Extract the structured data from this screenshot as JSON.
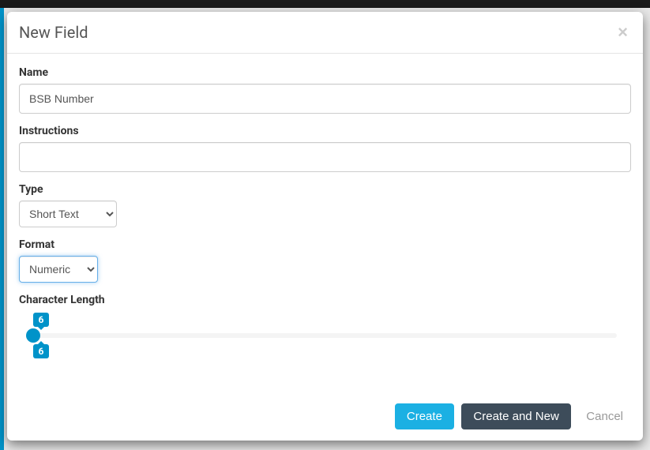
{
  "modal": {
    "title": "New Field",
    "close_label": "×"
  },
  "form": {
    "name": {
      "label": "Name",
      "value": "BSB Number"
    },
    "instructions": {
      "label": "Instructions",
      "value": ""
    },
    "type": {
      "label": "Type",
      "value": "Short Text"
    },
    "format": {
      "label": "Format",
      "value": "Numeric"
    },
    "char_length": {
      "label": "Character Length",
      "min_value": "6",
      "max_value": "6"
    }
  },
  "footer": {
    "create": "Create",
    "create_new": "Create and New",
    "cancel": "Cancel"
  }
}
